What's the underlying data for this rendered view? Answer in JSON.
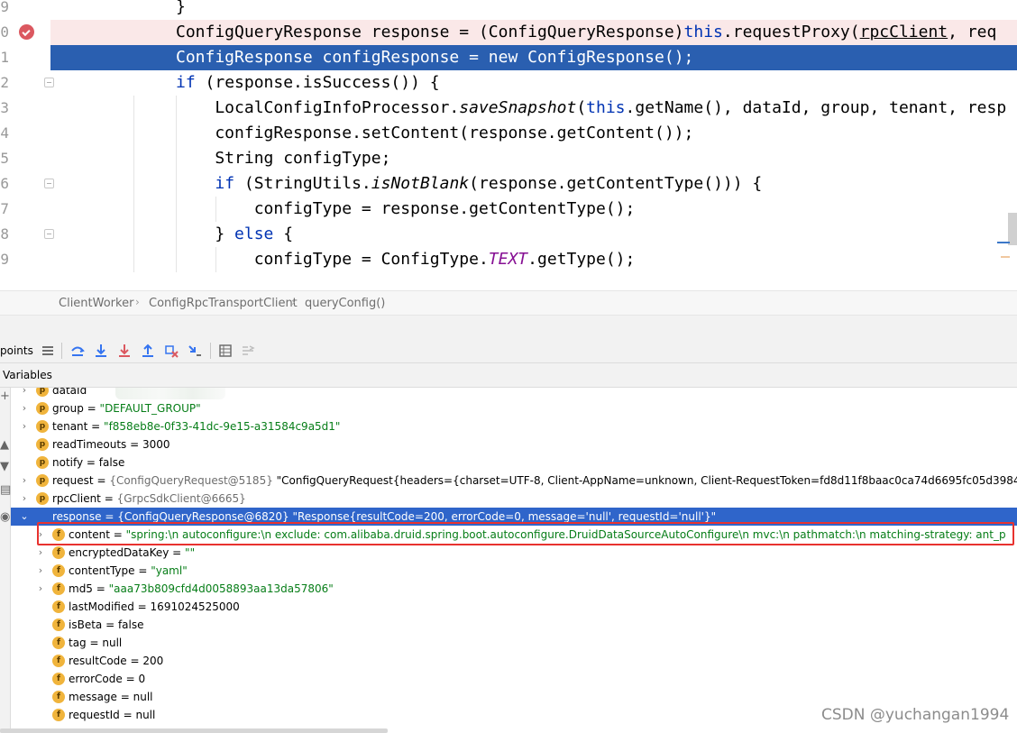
{
  "editor": {
    "line_numbers": [
      "9",
      "0",
      "1",
      "2",
      "3",
      "4",
      "5",
      "6",
      "7",
      "8",
      "9"
    ],
    "lines": [
      [
        {
          "t": "}"
        }
      ],
      [
        {
          "t": "ConfigQueryResponse response = (ConfigQueryResponse)"
        },
        {
          "t": "this",
          "c": "kw"
        },
        {
          "t": ".requestProxy("
        },
        {
          "t": "rpcClient",
          "c": "ul"
        },
        {
          "t": ", req"
        }
      ],
      [
        {
          "t": "ConfigResponse configResponse = "
        },
        {
          "t": "new",
          "c": "kw"
        },
        {
          "t": " ConfigResponse();"
        }
      ],
      [
        {
          "t": "if",
          "c": "kw"
        },
        {
          "t": " (response.isSuccess()) {"
        }
      ],
      [
        {
          "t": "    LocalConfigInfoProcessor."
        },
        {
          "t": "saveSnapshot",
          "c": "it"
        },
        {
          "t": "("
        },
        {
          "t": "this",
          "c": "kw"
        },
        {
          "t": ".getName(), dataId, group, tenant, resp"
        }
      ],
      [
        {
          "t": "    configResponse.setContent(response.getContent());"
        }
      ],
      [
        {
          "t": "    String configType;"
        }
      ],
      [
        {
          "t": "    "
        },
        {
          "t": "if",
          "c": "kw"
        },
        {
          "t": " (StringUtils."
        },
        {
          "t": "isNotBlank",
          "c": "it"
        },
        {
          "t": "(response.getContentType())) {"
        }
      ],
      [
        {
          "t": "        configType = response.getContentType();"
        }
      ],
      [
        {
          "t": "    } "
        },
        {
          "t": "else",
          "c": "kw"
        },
        {
          "t": " {"
        }
      ],
      [
        {
          "t": "        configType = ConfigType."
        },
        {
          "t": "TEXT",
          "c": "const"
        },
        {
          "t": ".getType();"
        }
      ]
    ],
    "breakpoint_color": "#db5860",
    "current_line_color": "#2a5fb0"
  },
  "breadcrumb": [
    "ClientWorker",
    "ConfigRpcTransportClient",
    "queryConfig()"
  ],
  "toolbar": {
    "breakpoints_label": "points",
    "icons": [
      "menu-icon",
      "step-over-icon",
      "step-into-icon",
      "force-step-into-icon",
      "step-out-icon",
      "drop-frame-icon",
      "run-to-cursor-icon",
      "evaluate-expression-icon",
      "trace-stream-icon"
    ]
  },
  "variables": {
    "tab_label": "Variables",
    "rows": [
      {
        "chev": ">",
        "badge": "p",
        "name": "dataId",
        "eq": "",
        "val": "",
        "blurred": true
      },
      {
        "chev": ">",
        "badge": "p",
        "name": "group",
        "eq": " = ",
        "val": "\"DEFAULT_GROUP\"",
        "kind": "str"
      },
      {
        "chev": ">",
        "badge": "p",
        "name": "tenant",
        "eq": " = ",
        "val": "\"f858eb8e-0f33-41dc-9e15-a31584c9a5d1\"",
        "kind": "str"
      },
      {
        "chev": "",
        "badge": "p",
        "name": "readTimeouts",
        "eq": " = ",
        "val": "3000"
      },
      {
        "chev": "",
        "badge": "p",
        "name": "notify",
        "eq": " = ",
        "val": "false"
      },
      {
        "chev": ">",
        "badge": "p",
        "name": "request",
        "eq": " = ",
        "ref": "{ConfigQueryRequest@5185} ",
        "val": "\"ConfigQueryRequest{headers={charset=UTF-8, Client-AppName=unknown, Client-RequestToken=fd8d11f8baac0ca74d6695fc05d39842, Client-I"
      },
      {
        "chev": ">",
        "badge": "p",
        "name": "rpcClient",
        "eq": " = ",
        "ref": "{GrpcSdkClient@6665}",
        "val": ""
      },
      {
        "chev": "v",
        "badge": "",
        "name": "response",
        "eq": " = ",
        "ref": "{ConfigQueryResponse@6820} ",
        "val": "\"Response{resultCode=200, errorCode=0, message='null', requestId='null'}\"",
        "selected": true
      },
      {
        "chev": ">",
        "badge": "f",
        "name": "content",
        "eq": " = ",
        "val": "\"spring:\\n  autoconfigure:\\n    exclude: com.alibaba.druid.spring.boot.autoconfigure.DruidDataSourceAutoConfigure\\n  mvc:\\n    pathmatch:\\n      matching-strategy: ant_p",
        "kind": "str",
        "indent": true
      },
      {
        "chev": ">",
        "badge": "f",
        "name": "encryptedDataKey",
        "eq": " = ",
        "val": "\"\"",
        "kind": "str",
        "indent": true
      },
      {
        "chev": ">",
        "badge": "f",
        "name": "contentType",
        "eq": " = ",
        "val": "\"yaml\"",
        "kind": "str",
        "indent": true
      },
      {
        "chev": ">",
        "badge": "f",
        "name": "md5",
        "eq": " = ",
        "val": "\"aaa73b809cfd4d0058893aa13da57806\"",
        "kind": "str",
        "indent": true
      },
      {
        "chev": "",
        "badge": "f",
        "name": "lastModified",
        "eq": " = ",
        "val": "1691024525000",
        "indent": true
      },
      {
        "chev": "",
        "badge": "f",
        "name": "isBeta",
        "eq": " = ",
        "val": "false",
        "indent": true
      },
      {
        "chev": "",
        "badge": "f",
        "name": "tag",
        "eq": " = ",
        "val": "null",
        "indent": true
      },
      {
        "chev": "",
        "badge": "f",
        "name": "resultCode",
        "eq": " = ",
        "val": "200",
        "indent": true
      },
      {
        "chev": "",
        "badge": "f",
        "name": "errorCode",
        "eq": " = ",
        "val": "0",
        "indent": true
      },
      {
        "chev": "",
        "badge": "f",
        "name": "message",
        "eq": " = ",
        "val": "null",
        "indent": true
      },
      {
        "chev": "",
        "badge": "f",
        "name": "requestId",
        "eq": " = ",
        "val": "null",
        "indent": true
      }
    ]
  },
  "watermark": "CSDN @yuchangan1994"
}
